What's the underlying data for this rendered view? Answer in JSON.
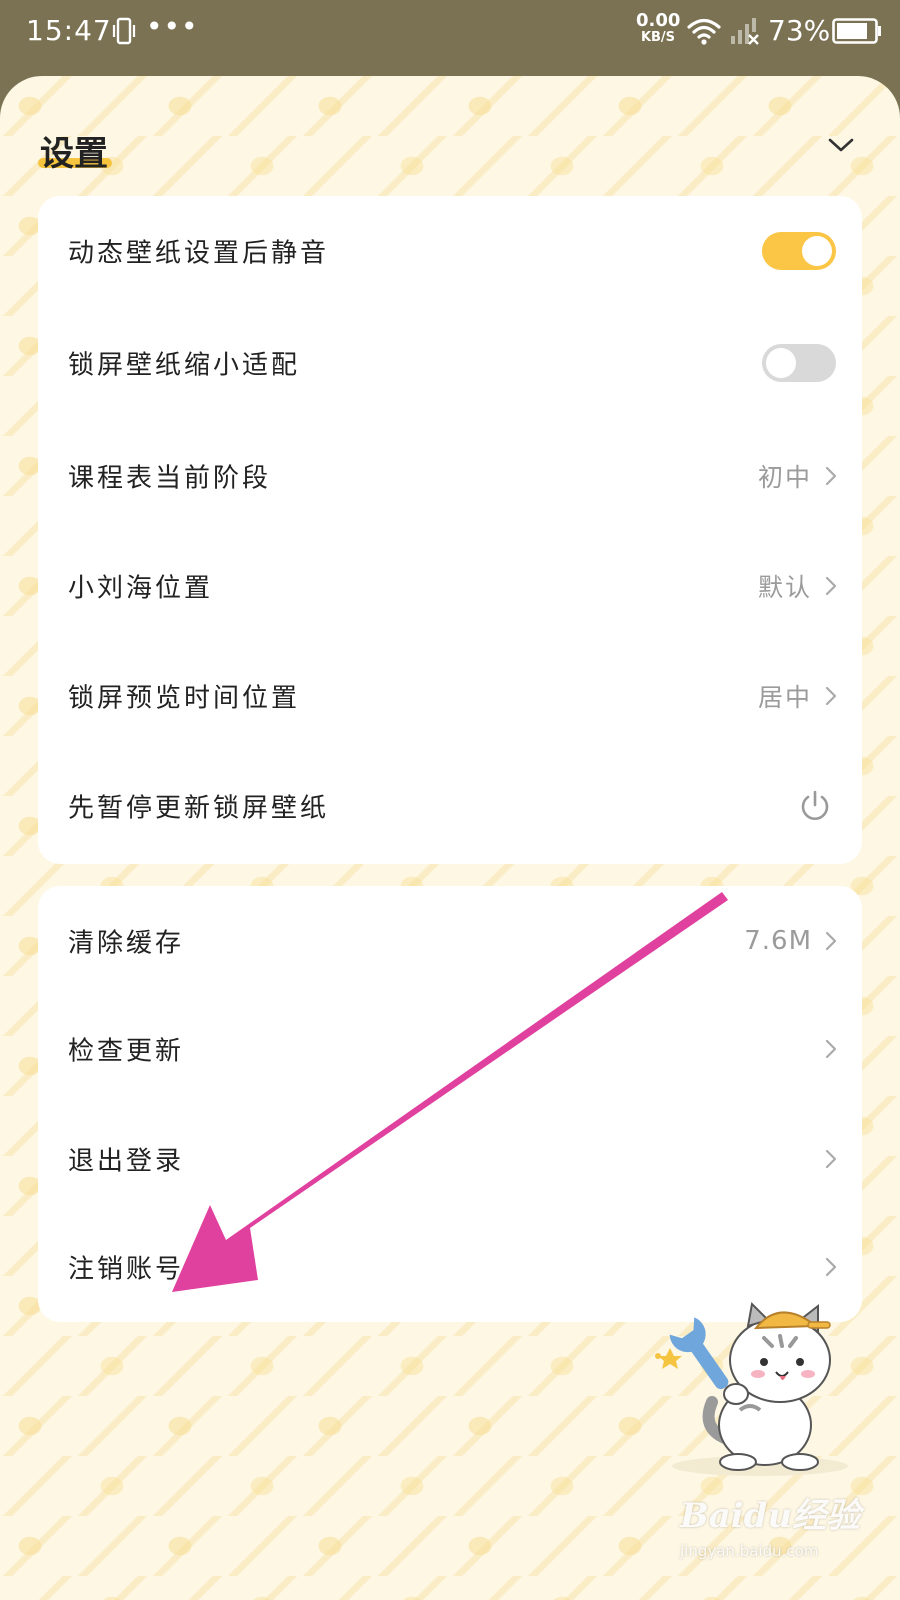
{
  "status_bar": {
    "time": "15:47",
    "dots": "•••",
    "speed_value": "0.00",
    "speed_unit": "KB/S",
    "battery": "73%"
  },
  "header": {
    "title": "设置"
  },
  "settings_group_1": [
    {
      "label": "动态壁纸设置后静音",
      "control": "toggle",
      "checked": true
    },
    {
      "label": "锁屏壁纸缩小适配",
      "control": "toggle",
      "checked": false
    },
    {
      "label": "课程表当前阶段",
      "value": "初中",
      "control": "chevron"
    },
    {
      "label": "小刘海位置",
      "value": "默认",
      "control": "chevron"
    },
    {
      "label": "锁屏预览时间位置",
      "value": "居中",
      "control": "chevron"
    },
    {
      "label": "先暂停更新锁屏壁纸",
      "control": "power-icon"
    }
  ],
  "settings_group_2": [
    {
      "label": "清除缓存",
      "value": "7.6M",
      "control": "chevron"
    },
    {
      "label": "检查更新",
      "control": "chevron"
    },
    {
      "label": "退出登录",
      "control": "chevron"
    },
    {
      "label": "注销账号",
      "control": "chevron"
    }
  ],
  "watermark": {
    "logo_text": "Baidu经验",
    "url": "jingyan.baidu.com"
  },
  "colors": {
    "accent": "#fbc545",
    "annotation_arrow": "#e0409e",
    "status_bar": "#7a7253"
  }
}
